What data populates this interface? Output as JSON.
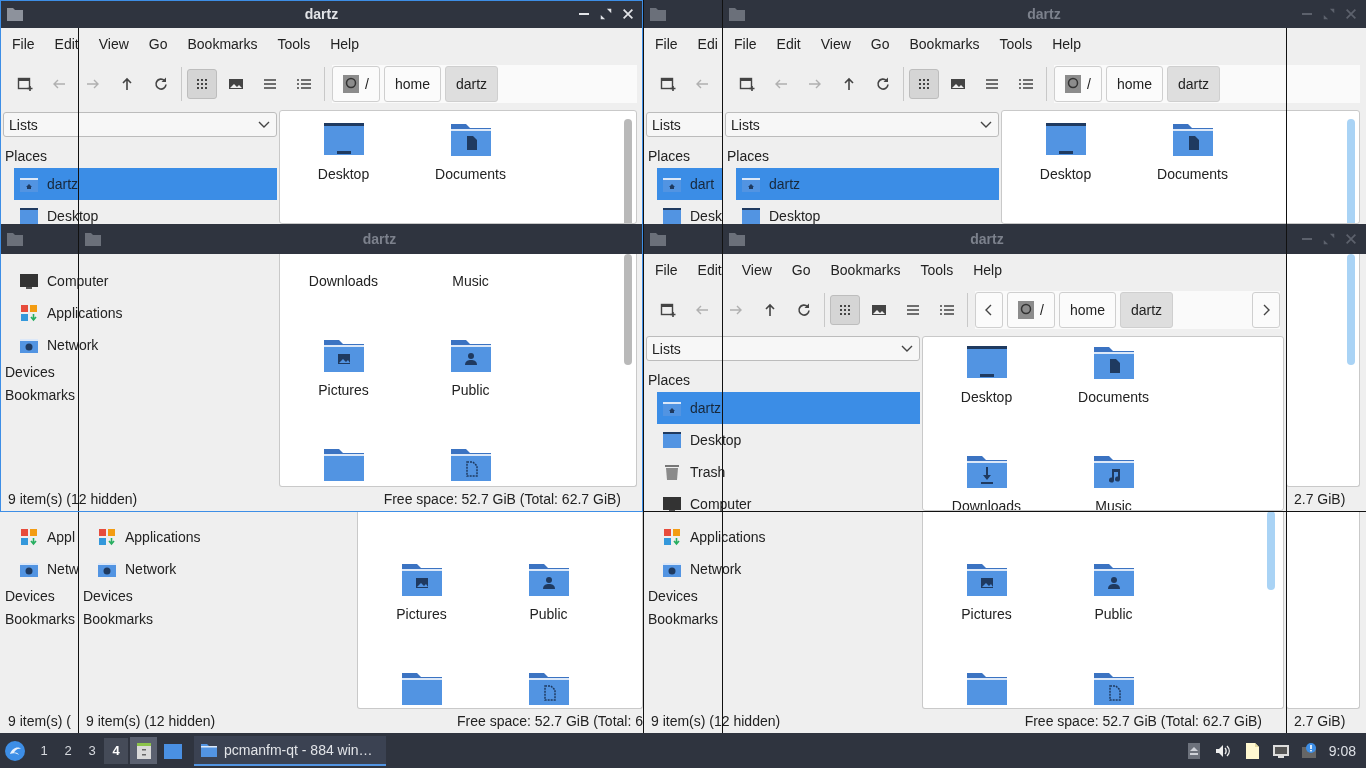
{
  "panes": [
    {
      "title_bars": [
        {
          "title": "dartz",
          "active": true,
          "controls": true
        }
      ],
      "menu": [
        "File",
        "Edit",
        "View",
        "Go",
        "Bookmarks",
        "Tools",
        "Help"
      ],
      "toolbar": {
        "buttons": [
          {
            "kind": "new-tab",
            "disabled": false
          },
          {
            "kind": "back",
            "disabled": true
          },
          {
            "kind": "forward",
            "disabled": true
          },
          {
            "kind": "up",
            "disabled": false
          },
          {
            "kind": "reload",
            "disabled": false
          }
        ],
        "views": [
          {
            "kind": "icons",
            "selected": true
          },
          {
            "kind": "thumbnails",
            "selected": false
          },
          {
            "kind": "compact",
            "selected": false
          },
          {
            "kind": "details",
            "selected": false
          }
        ],
        "crumbs": [
          {
            "kind": "root",
            "label": "/",
            "selected": false
          },
          {
            "kind": "dir",
            "label": "home",
            "selected": false
          },
          {
            "kind": "dir",
            "label": "dartz",
            "selected": true
          }
        ]
      },
      "sidebar": {
        "dropdown": "Lists",
        "items": [
          {
            "kind": "header",
            "label": "Places"
          },
          {
            "kind": "home",
            "label": "dartz",
            "selected": true
          },
          {
            "kind": "desktop",
            "label": "Desktop",
            "selected": false
          }
        ]
      },
      "files": [
        {
          "kind": "desktop",
          "label": "Desktop"
        },
        {
          "kind": "documents",
          "label": "Documents"
        }
      ]
    },
    {
      "title_bars": [
        {
          "active": false
        },
        {
          "title": "dartz",
          "active": false
        }
      ]
    },
    {
      "sidebar": {
        "items": [
          {
            "kind": "computer",
            "label": "Computer",
            "selected": false
          },
          {
            "kind": "applications",
            "label": "Applications",
            "selected": false
          },
          {
            "kind": "network",
            "label": "Network",
            "selected": false
          },
          {
            "kind": "header",
            "label": "Devices"
          },
          {
            "kind": "header",
            "label": "Bookmarks"
          }
        ]
      },
      "files": [
        {
          "kind": "caption",
          "label": "Downloads"
        },
        {
          "kind": "caption",
          "label": "Music"
        },
        {
          "kind": "pictures",
          "label": "Pictures"
        },
        {
          "kind": "public",
          "label": "Public"
        },
        {
          "kind": "folder"
        },
        {
          "kind": "templates"
        }
      ],
      "status": {
        "left": "9 item(s) (12 hidden)",
        "right": "Free space: 52.7 GiB (Total: 62.7 GiB)"
      }
    },
    {
      "sidebar": {
        "items": [
          {
            "kind": "applications",
            "label": "Appl",
            "selected": false
          },
          {
            "kind": "network",
            "label": "Netw",
            "selected": false
          },
          {
            "kind": "header",
            "label": "Devices"
          },
          {
            "kind": "header",
            "label": "Bookmarks"
          }
        ]
      },
      "status": {
        "left": "9 item(s) ("
      }
    },
    {
      "sidebar": {
        "items": [
          {
            "kind": "applications",
            "label": "Applications",
            "selected": false
          },
          {
            "kind": "network",
            "label": "Network",
            "selected": false
          },
          {
            "kind": "header",
            "label": "Devices"
          },
          {
            "kind": "header",
            "label": "Bookmarks"
          }
        ]
      },
      "files": [
        {
          "kind": "pictures",
          "label": "Pictures"
        },
        {
          "kind": "public",
          "label": "Public"
        },
        {
          "kind": "folder"
        },
        {
          "kind": "templates"
        }
      ],
      "status": {
        "left": "9 item(s) (12 hidden)",
        "right": "Free space: 52.7 GiB (Total: 6"
      }
    },
    {
      "title_bars": [
        {
          "active": false
        }
      ],
      "menu": [
        "File",
        "Edi"
      ],
      "toolbar": {
        "buttons": [
          {
            "kind": "new-tab",
            "disabled": false
          },
          {
            "kind": "back",
            "disabled": true
          }
        ]
      },
      "sidebar": {
        "dropdown": "Lists",
        "items": [
          {
            "kind": "header",
            "label": "Places"
          },
          {
            "kind": "home",
            "label": "dart",
            "selected": true
          },
          {
            "kind": "desktop",
            "label": "Desk",
            "selected": false
          }
        ]
      }
    },
    {
      "title_bars": [
        {
          "title": "dartz",
          "active": false,
          "controls": true
        }
      ],
      "menu": [
        "File",
        "Edit",
        "View",
        "Go",
        "Bookmarks",
        "Tools",
        "Help"
      ],
      "toolbar": {
        "buttons": [
          {
            "kind": "new-tab",
            "disabled": false
          },
          {
            "kind": "back",
            "disabled": true
          },
          {
            "kind": "forward",
            "disabled": true
          },
          {
            "kind": "up",
            "disabled": false
          },
          {
            "kind": "reload",
            "disabled": false
          }
        ],
        "views": [
          {
            "kind": "icons",
            "selected": true
          },
          {
            "kind": "thumbnails",
            "selected": false
          },
          {
            "kind": "compact",
            "selected": false
          },
          {
            "kind": "details",
            "selected": false
          }
        ],
        "crumbs": [
          {
            "kind": "root",
            "label": "/",
            "selected": false
          },
          {
            "kind": "dir",
            "label": "home",
            "selected": false
          },
          {
            "kind": "dir",
            "label": "dartz",
            "selected": true
          }
        ]
      },
      "sidebar": {
        "dropdown": "Lists",
        "items": [
          {
            "kind": "header",
            "label": "Places"
          },
          {
            "kind": "home",
            "label": "dartz",
            "selected": true
          },
          {
            "kind": "desktop",
            "label": "Desktop",
            "selected": false
          }
        ]
      },
      "files": [
        {
          "kind": "desktop",
          "label": "Desktop"
        },
        {
          "kind": "documents",
          "label": "Documents"
        }
      ]
    },
    {
      "title_bars": [
        {
          "active": false
        },
        {
          "title": "dartz",
          "active": false,
          "controls": true
        }
      ]
    },
    {
      "menu": [
        "File",
        "Edit",
        "View",
        "Go",
        "Bookmarks",
        "Tools",
        "Help"
      ],
      "toolbar": {
        "buttons": [
          {
            "kind": "new-tab",
            "disabled": false
          },
          {
            "kind": "back",
            "disabled": true
          },
          {
            "kind": "forward",
            "disabled": true
          },
          {
            "kind": "up",
            "disabled": false
          },
          {
            "kind": "reload",
            "disabled": false
          }
        ],
        "views": [
          {
            "kind": "icons",
            "selected": true
          },
          {
            "kind": "thumbnails",
            "selected": false
          },
          {
            "kind": "compact",
            "selected": false
          },
          {
            "kind": "details",
            "selected": false
          }
        ],
        "scroll_arrows": true,
        "crumbs": [
          {
            "kind": "root",
            "label": "/",
            "selected": false
          },
          {
            "kind": "dir",
            "label": "home",
            "selected": false
          },
          {
            "kind": "dir",
            "label": "dartz",
            "selected": true
          }
        ]
      },
      "sidebar": {
        "dropdown": "Lists",
        "items": [
          {
            "kind": "header",
            "label": "Places"
          },
          {
            "kind": "home",
            "label": "dartz",
            "selected": true
          },
          {
            "kind": "desktop",
            "label": "Desktop",
            "selected": false
          },
          {
            "kind": "trash",
            "label": "Trash",
            "selected": false
          },
          {
            "kind": "computer",
            "label": "Computer",
            "selected": false
          }
        ]
      },
      "files": [
        {
          "kind": "desktop",
          "label": "Desktop"
        },
        {
          "kind": "documents",
          "label": "Documents"
        },
        {
          "kind": "downloads",
          "label": "Downloads"
        },
        {
          "kind": "music",
          "label": "Music"
        }
      ]
    },
    {
      "status": {
        "right": "2.7 GiB)"
      }
    },
    {
      "sidebar": {
        "items": [
          {
            "kind": "applications",
            "label": "Applications",
            "selected": false
          },
          {
            "kind": "network",
            "label": "Network",
            "selected": false
          },
          {
            "kind": "header",
            "label": "Devices"
          },
          {
            "kind": "header",
            "label": "Bookmarks"
          }
        ]
      },
      "files": [
        {
          "kind": "pictures",
          "label": "Pictures"
        },
        {
          "kind": "public",
          "label": "Public"
        },
        {
          "kind": "folder"
        },
        {
          "kind": "templates"
        }
      ],
      "status": {
        "left": "9 item(s) (12 hidden)",
        "right": "Free space: 52.7 GiB (Total: 62.7 GiB)"
      }
    },
    {
      "status": {
        "right": "2.7 GiB)"
      }
    }
  ],
  "taskbar": {
    "workspaces": [
      {
        "label": "1",
        "selected": false
      },
      {
        "label": "2",
        "selected": false
      },
      {
        "label": "3",
        "selected": false
      },
      {
        "label": "4",
        "selected": true
      }
    ],
    "task": {
      "label": "pcmanfm-qt - 884 win…",
      "selected": true
    },
    "clock": "9:08"
  }
}
